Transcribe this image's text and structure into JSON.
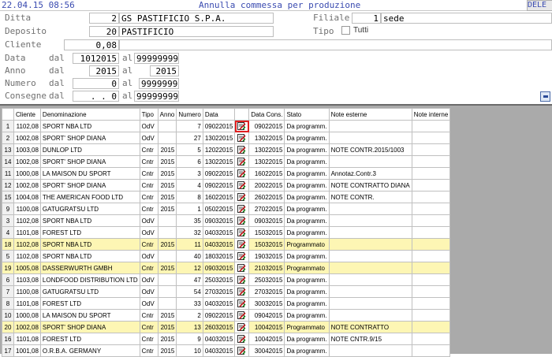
{
  "header": {
    "timestamp": "22.04.15 08:56",
    "title": "Annulla commessa per produzione",
    "corner": "DELE"
  },
  "form": {
    "ditta": {
      "label": "Ditta",
      "code": "2",
      "name": "GS PASTIFICIO S.P.A."
    },
    "filiale": {
      "label": "Filiale",
      "code": "1",
      "name": "sede"
    },
    "deposito": {
      "label": "Deposito",
      "code": "20",
      "name": "PASTIFICIO"
    },
    "tipo": {
      "label": "Tipo",
      "option": "Tutti"
    },
    "cliente": {
      "label": "Cliente",
      "value": "0,08"
    },
    "data": {
      "label": "Data",
      "dal_label": "dal",
      "from": "1012015",
      "al_label": "al",
      "to": "99999999"
    },
    "anno": {
      "label": "Anno",
      "dal_label": "dal",
      "from": "2015",
      "al_label": "al",
      "to": "2015"
    },
    "numero": {
      "label": "Numero",
      "dal_label": "dal",
      "from": "0",
      "al_label": "al",
      "to": "9999999"
    },
    "consegne": {
      "label": "Consegne",
      "dal_label": "dal",
      "from": ". .      0",
      "al_label": "al",
      "to": "99999999"
    }
  },
  "grid": {
    "columns": [
      "",
      "Cliente",
      "Denominazione",
      "Tipo",
      "Anno",
      "Numero",
      "Data",
      "",
      "Data Cons.",
      "Stato",
      "Note esterne",
      "Note interne"
    ],
    "rows": [
      {
        "n": "1",
        "cliente": "1102,08",
        "den": "SPORT NBA LTD",
        "tipo": "OdV",
        "anno": "",
        "numero": "7",
        "data": "09022015",
        "cons": "09022015",
        "stato": "Da programm.",
        "note_est": "",
        "note_int": "",
        "hl": false,
        "sel": true
      },
      {
        "n": "2",
        "cliente": "1002,08",
        "den": "SPORT' SHOP DIANA",
        "tipo": "OdV",
        "anno": "",
        "numero": "27",
        "data": "13022015",
        "cons": "13022015",
        "stato": "Da programm.",
        "note_est": "",
        "note_int": "",
        "hl": false
      },
      {
        "n": "13",
        "cliente": "1003,08",
        "den": "DUNLOP LTD",
        "tipo": "Cntr",
        "anno": "2015",
        "numero": "5",
        "data": "12022015",
        "cons": "13022015",
        "stato": "Da programm.",
        "note_est": "NOTE CONTR.2015/1003",
        "note_int": "",
        "hl": false
      },
      {
        "n": "14",
        "cliente": "1002,08",
        "den": "SPORT' SHOP DIANA",
        "tipo": "Cntr",
        "anno": "2015",
        "numero": "6",
        "data": "13022015",
        "cons": "13022015",
        "stato": "Da programm.",
        "note_est": "",
        "note_int": "",
        "hl": false
      },
      {
        "n": "11",
        "cliente": "1000,08",
        "den": "LA MAISON DU SPORT",
        "tipo": "Cntr",
        "anno": "2015",
        "numero": "3",
        "data": "09022015",
        "cons": "16022015",
        "stato": "Da programm.",
        "note_est": "Annotaz.Contr.3",
        "note_int": "",
        "hl": false
      },
      {
        "n": "12",
        "cliente": "1002,08",
        "den": "SPORT' SHOP DIANA",
        "tipo": "Cntr",
        "anno": "2015",
        "numero": "4",
        "data": "09022015",
        "cons": "20022015",
        "stato": "Da programm.",
        "note_est": "NOTE CONTRATTO DIANA",
        "note_int": "",
        "hl": false
      },
      {
        "n": "15",
        "cliente": "1004,08",
        "den": "THE AMERICAN FOOD LTD",
        "tipo": "Cntr",
        "anno": "2015",
        "numero": "8",
        "data": "16022015",
        "cons": "26022015",
        "stato": "Da programm.",
        "note_est": "NOTE CONTR.",
        "note_int": "",
        "hl": false
      },
      {
        "n": "9",
        "cliente": "1100,08",
        "den": "GATUGRATSU LTD",
        "tipo": "Cntr",
        "anno": "2015",
        "numero": "1",
        "data": "05022015",
        "cons": "27022015",
        "stato": "Da programm.",
        "note_est": "",
        "note_int": "",
        "hl": false
      },
      {
        "n": "3",
        "cliente": "1102,08",
        "den": "SPORT NBA LTD",
        "tipo": "OdV",
        "anno": "",
        "numero": "35",
        "data": "09032015",
        "cons": "09032015",
        "stato": "Da programm.",
        "note_est": "",
        "note_int": "",
        "hl": false
      },
      {
        "n": "4",
        "cliente": "1101,08",
        "den": "FOREST LTD",
        "tipo": "OdV",
        "anno": "",
        "numero": "32",
        "data": "04032015",
        "cons": "15032015",
        "stato": "Da programm.",
        "note_est": "",
        "note_int": "",
        "hl": false
      },
      {
        "n": "18",
        "cliente": "1102,08",
        "den": "SPORT NBA LTD",
        "tipo": "Cntr",
        "anno": "2015",
        "numero": "11",
        "data": "04032015",
        "cons": "15032015",
        "stato": "Programmato",
        "note_est": "",
        "note_int": "",
        "hl": true
      },
      {
        "n": "5",
        "cliente": "1102,08",
        "den": "SPORT NBA LTD",
        "tipo": "OdV",
        "anno": "",
        "numero": "40",
        "data": "18032015",
        "cons": "19032015",
        "stato": "Da programm.",
        "note_est": "",
        "note_int": "",
        "hl": false
      },
      {
        "n": "19",
        "cliente": "1005,08",
        "den": "DASSERWURTH GMBH",
        "tipo": "Cntr",
        "anno": "2015",
        "numero": "12",
        "data": "09032015",
        "cons": "21032015",
        "stato": "Programmato",
        "note_est": "",
        "note_int": "",
        "hl": true
      },
      {
        "n": "6",
        "cliente": "1103,08",
        "den": "LONDFOOD DISTRIBUTION LTD",
        "tipo": "OdV",
        "anno": "",
        "numero": "47",
        "data": "25032015",
        "cons": "25032015",
        "stato": "Da programm.",
        "note_est": "",
        "note_int": "",
        "hl": false
      },
      {
        "n": "7",
        "cliente": "1100,08",
        "den": "GATUGRATSU LTD",
        "tipo": "OdV",
        "anno": "",
        "numero": "54",
        "data": "27032015",
        "cons": "27032015",
        "stato": "Da programm.",
        "note_est": "",
        "note_int": "",
        "hl": false
      },
      {
        "n": "8",
        "cliente": "1101,08",
        "den": "FOREST LTD",
        "tipo": "OdV",
        "anno": "",
        "numero": "33",
        "data": "04032015",
        "cons": "30032015",
        "stato": "Da programm.",
        "note_est": "",
        "note_int": "",
        "hl": false
      },
      {
        "n": "10",
        "cliente": "1000,08",
        "den": "LA MAISON DU SPORT",
        "tipo": "Cntr",
        "anno": "2015",
        "numero": "2",
        "data": "09022015",
        "cons": "09042015",
        "stato": "Da programm.",
        "note_est": "",
        "note_int": "",
        "hl": false
      },
      {
        "n": "20",
        "cliente": "1002,08",
        "den": "SPORT' SHOP DIANA",
        "tipo": "Cntr",
        "anno": "2015",
        "numero": "13",
        "data": "26032015",
        "cons": "10042015",
        "stato": "Programmato",
        "note_est": "NOTE CONTRATTO",
        "note_int": "",
        "hl": true
      },
      {
        "n": "16",
        "cliente": "1101,08",
        "den": "FOREST LTD",
        "tipo": "Cntr",
        "anno": "2015",
        "numero": "9",
        "data": "04032015",
        "cons": "10042015",
        "stato": "Da programm.",
        "note_est": "NOTE CNTR.9/15",
        "note_int": "",
        "hl": false
      },
      {
        "n": "17",
        "cliente": "1001,08",
        "den": "O.R.B.A. GERMANY",
        "tipo": "Cntr",
        "anno": "2015",
        "numero": "10",
        "data": "04032015",
        "cons": "30042015",
        "stato": "Da programm.",
        "note_est": "",
        "note_int": "",
        "hl": false
      }
    ]
  }
}
